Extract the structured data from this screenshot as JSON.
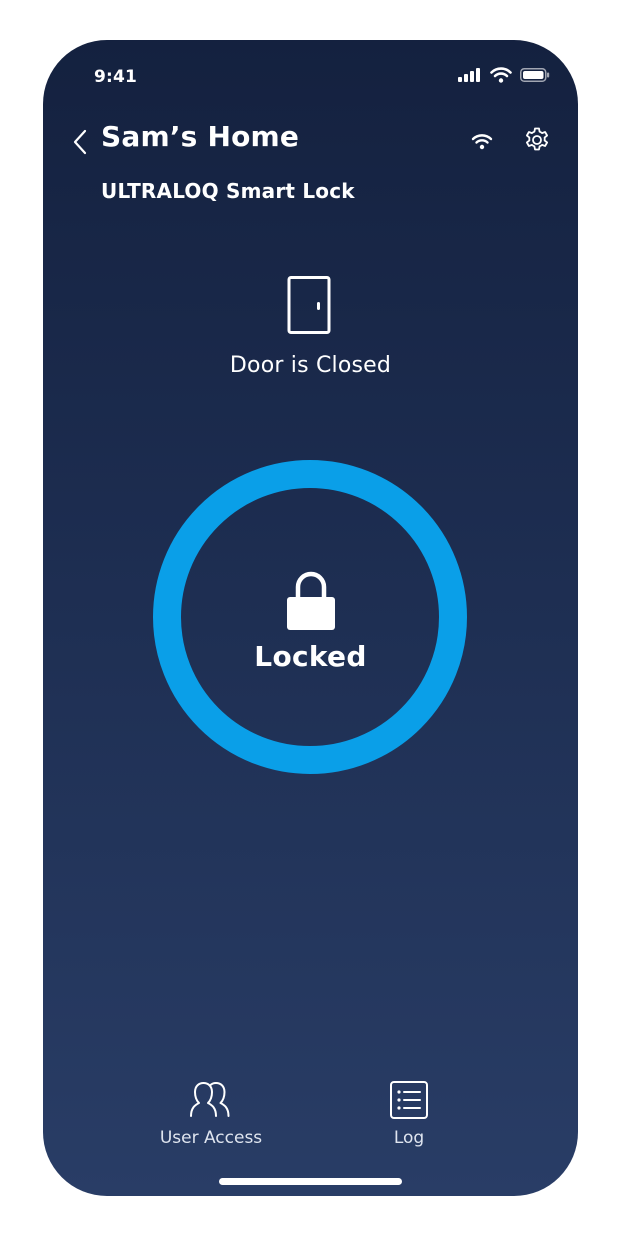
{
  "status_bar": {
    "time": "9:41",
    "icons": [
      "cellular-signal-icon",
      "wifi-icon",
      "battery-icon"
    ]
  },
  "header": {
    "title": "Sam’s Home",
    "back_icon": "chevron-left-icon",
    "wifi_icon": "wifi-icon",
    "settings_icon": "gear-icon"
  },
  "device": {
    "name": "ULTRALOQ Smart Lock"
  },
  "door": {
    "icon": "door-icon",
    "status": "Door is Closed"
  },
  "lock": {
    "icon": "padlock-icon",
    "status": "Locked",
    "ring_color": "#0a9fe8"
  },
  "tabs": [
    {
      "label": "User Access",
      "icon": "users-icon"
    },
    {
      "label": "Log",
      "icon": "list-icon"
    }
  ],
  "colors": {
    "background_top": "#14213f",
    "background_bottom": "#293d66",
    "accent": "#0a9fe8"
  }
}
